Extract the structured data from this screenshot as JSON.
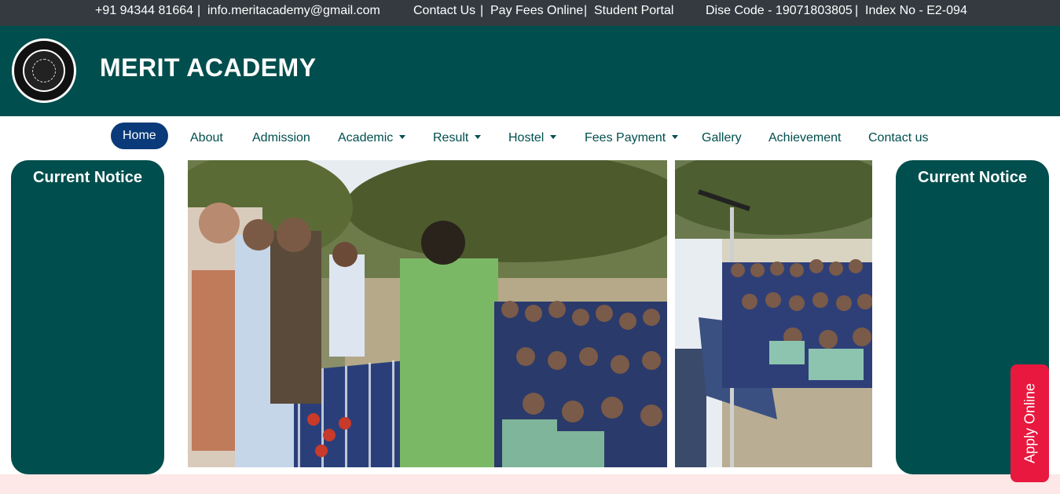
{
  "topbar": {
    "phone": "+91 94344 81664",
    "email": "info.meritacademy@gmail.com",
    "contact": "Contact Us",
    "pay": "Pay Fees Online",
    "portal": "Student Portal",
    "dise": "Dise Code - 19071803805",
    "index": "Index No - E2-094",
    "separator": "|"
  },
  "header": {
    "title": "MERIT ACADEMY",
    "logo_icon": "school-seal-logo"
  },
  "nav": {
    "items": [
      {
        "label": "Home",
        "active": true
      },
      {
        "label": "About"
      },
      {
        "label": "Admission"
      },
      {
        "label": "Academic",
        "dropdown": true
      },
      {
        "label": "Result",
        "dropdown": true
      },
      {
        "label": "Hostel",
        "dropdown": true
      },
      {
        "label": "Fees Payment",
        "dropdown": true
      },
      {
        "label": "Gallery"
      },
      {
        "label": "Achievement"
      },
      {
        "label": "Contact us"
      }
    ]
  },
  "notices": {
    "left_title": "Current Notice",
    "right_title": "Current Notice"
  },
  "apply": {
    "label": "Apply Online"
  },
  "colors": {
    "topbar": "#343a40",
    "brand": "#004e4d",
    "nav_active": "#0a3a7a",
    "apply": "#e8183f",
    "footer_band": "#fde7e7"
  }
}
